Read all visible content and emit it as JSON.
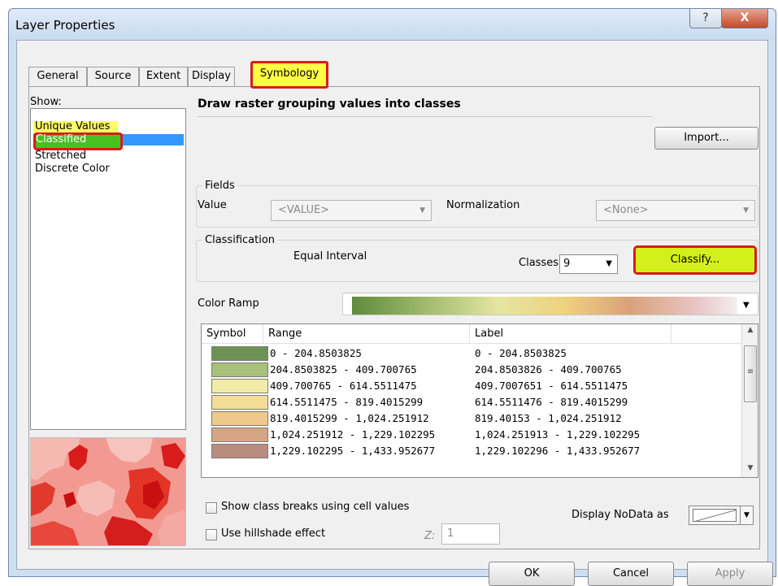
{
  "window": {
    "title": "Layer Properties",
    "help_glyph": "?",
    "close_glyph": "X"
  },
  "tabs": [
    {
      "label": "General"
    },
    {
      "label": "Source"
    },
    {
      "label": "Extent"
    },
    {
      "label": "Display"
    },
    {
      "label": "Symbology",
      "selected": true
    }
  ],
  "show": {
    "label": "Show:",
    "items": [
      {
        "label": "Unique Values"
      },
      {
        "label": "Classified",
        "selected": true
      },
      {
        "label": "Stretched"
      },
      {
        "label": "Discrete Color"
      }
    ]
  },
  "heading": "Draw raster grouping values into classes",
  "import_label": "Import...",
  "fields": {
    "legend": "Fields",
    "value_label": "Value",
    "value_combo": "<VALUE>",
    "normalization_label": "Normalization",
    "normalization_combo": "<None>"
  },
  "classification": {
    "legend": "Classification",
    "method": "Equal Interval",
    "classes_label": "Classes",
    "classes_value": "9",
    "classify_label": "Classify..."
  },
  "color_ramp_label": "Color Ramp",
  "table": {
    "headers": {
      "symbol": "Symbol",
      "range": "Range",
      "label": "Label"
    },
    "rows": [
      {
        "color": "#6e9253",
        "range": "0 - 204.8503825",
        "label": "0 - 204.8503825"
      },
      {
        "color": "#a8c07a",
        "range": "204.8503825 - 409.700765",
        "label": "204.8503826 - 409.700765"
      },
      {
        "color": "#f0eca8",
        "range": "409.700765 - 614.5511475",
        "label": "409.7007651 - 614.5511475"
      },
      {
        "color": "#f3dc95",
        "range": "614.5511475 - 819.4015299",
        "label": "614.5511476 - 819.4015299"
      },
      {
        "color": "#eec98a",
        "range": "819.4015299 - 1,024.251912",
        "label": "819.40153 - 1,024.251912"
      },
      {
        "color": "#d6a584",
        "range": "1,024.251912 - 1,229.102295",
        "label": "1,024.251913 - 1,229.102295"
      },
      {
        "color": "#b98c80",
        "range": "1,229.102295 - 1,433.952677",
        "label": "1,229.102296 - 1,433.952677"
      }
    ]
  },
  "options": {
    "show_breaks_label": "Show class breaks using cell values",
    "hillshade_label": "Use hillshade effect",
    "z_label": "Z:",
    "z_value": "1",
    "nodata_label": "Display NoData as"
  },
  "buttons": {
    "ok": "OK",
    "cancel": "Cancel",
    "apply": "Apply"
  },
  "colors": {
    "highlight_yellow": "#ffff44",
    "annotation_red": "#d81b1b",
    "classify_green": "#d4f01a",
    "selection_blue": "#3399ff"
  }
}
